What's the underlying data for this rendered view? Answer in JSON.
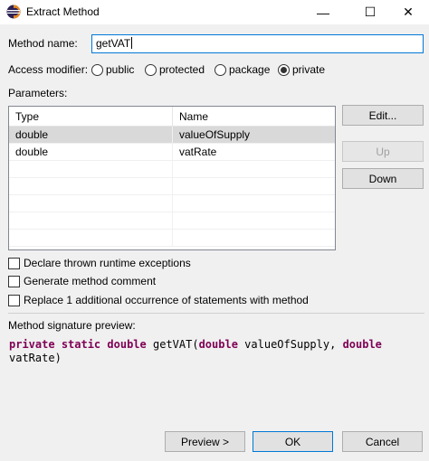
{
  "window": {
    "title": "Extract Method",
    "icon": "eclipse-icon",
    "minimize": "—",
    "maximize": "☐",
    "close": "✕"
  },
  "method_name": {
    "label": "Method name:",
    "value": "getVAT"
  },
  "access": {
    "label": "Access modifier:",
    "options": [
      "public",
      "protected",
      "package",
      "private"
    ],
    "selected": "private"
  },
  "parameters": {
    "label": "Parameters:",
    "columns": [
      "Type",
      "Name"
    ],
    "rows": [
      {
        "type": "double",
        "name": "valueOfSupply"
      },
      {
        "type": "double",
        "name": "vatRate"
      }
    ]
  },
  "param_buttons": {
    "edit": "Edit...",
    "up": "Up",
    "down": "Down"
  },
  "options": {
    "declare_exceptions": "Declare thrown runtime exceptions",
    "generate_comment": "Generate method comment",
    "replace_occurrences": "Replace 1 additional occurrence of statements with method"
  },
  "preview": {
    "label": "Method signature preview:",
    "line1_kw1": "private",
    "line1_kw2": "static",
    "line1_kw3": "double",
    "line1_name": "getVAT(",
    "line1_kw4": "double",
    "line1_p1": "valueOfSupply,",
    "line1_kw5": "double",
    "line2": "vatRate)"
  },
  "footer": {
    "preview": "Preview >",
    "ok": "OK",
    "cancel": "Cancel"
  },
  "colors": {
    "keyword": "#7f0055",
    "focus": "#0078d7",
    "selected_row": "#d9d9d9"
  }
}
